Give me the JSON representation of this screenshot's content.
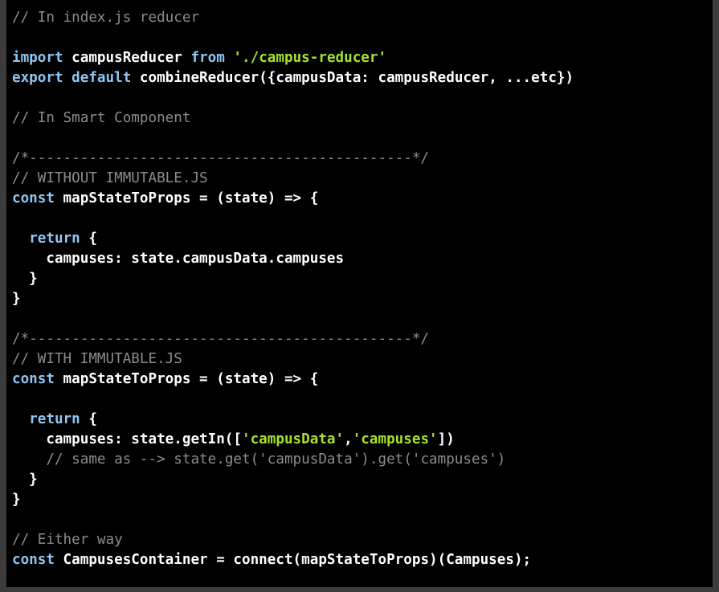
{
  "colors": {
    "background": "#000000",
    "frame": "#3c3c3c",
    "plain": "#ffffff",
    "keyword": "#8fc6f4",
    "string": "#a6e22e",
    "comment": "#8c8c8c"
  },
  "code_lines": [
    [
      {
        "t": "comment",
        "v": "// In index.js reducer"
      }
    ],
    [],
    [
      {
        "t": "kw",
        "v": "import"
      },
      {
        "t": "plain",
        "v": " campusReducer "
      },
      {
        "t": "kw",
        "v": "from"
      },
      {
        "t": "plain",
        "v": " "
      },
      {
        "t": "str",
        "v": "'./campus-reducer'"
      }
    ],
    [
      {
        "t": "kw",
        "v": "export"
      },
      {
        "t": "plain",
        "v": " "
      },
      {
        "t": "kw",
        "v": "default"
      },
      {
        "t": "plain",
        "v": " combineReducer({campusData: campusReducer, ...etc})"
      }
    ],
    [],
    [
      {
        "t": "comment",
        "v": "// In Smart Component"
      }
    ],
    [],
    [
      {
        "t": "comment",
        "v": "/*---------------------------------------------*/"
      }
    ],
    [
      {
        "t": "comment",
        "v": "// WITHOUT IMMUTABLE.JS"
      }
    ],
    [
      {
        "t": "kw",
        "v": "const"
      },
      {
        "t": "plain",
        "v": " mapStateToProps = (state) => {"
      }
    ],
    [],
    [
      {
        "t": "plain",
        "v": "  "
      },
      {
        "t": "kw",
        "v": "return"
      },
      {
        "t": "plain",
        "v": " {"
      }
    ],
    [
      {
        "t": "plain",
        "v": "    campuses: state.campusData.campuses"
      }
    ],
    [
      {
        "t": "plain",
        "v": "  }"
      }
    ],
    [
      {
        "t": "plain",
        "v": "}"
      }
    ],
    [],
    [
      {
        "t": "comment",
        "v": "/*---------------------------------------------*/"
      }
    ],
    [
      {
        "t": "comment",
        "v": "// WITH IMMUTABLE.JS"
      }
    ],
    [
      {
        "t": "kw",
        "v": "const"
      },
      {
        "t": "plain",
        "v": " mapStateToProps = (state) => {"
      }
    ],
    [],
    [
      {
        "t": "plain",
        "v": "  "
      },
      {
        "t": "kw",
        "v": "return"
      },
      {
        "t": "plain",
        "v": " {"
      }
    ],
    [
      {
        "t": "plain",
        "v": "    campuses: state.getIn(["
      },
      {
        "t": "str",
        "v": "'campusData'"
      },
      {
        "t": "plain",
        "v": ","
      },
      {
        "t": "str",
        "v": "'campuses'"
      },
      {
        "t": "plain",
        "v": "])"
      }
    ],
    [
      {
        "t": "plain",
        "v": "    "
      },
      {
        "t": "comment",
        "v": "// same as --> state.get('campusData').get('campuses')"
      }
    ],
    [
      {
        "t": "plain",
        "v": "  }"
      }
    ],
    [
      {
        "t": "plain",
        "v": "}"
      }
    ],
    [],
    [
      {
        "t": "comment",
        "v": "// Either way"
      }
    ],
    [
      {
        "t": "kw",
        "v": "const"
      },
      {
        "t": "plain",
        "v": " CampusesContainer = connect(mapStateToProps)(Campuses);"
      }
    ]
  ]
}
